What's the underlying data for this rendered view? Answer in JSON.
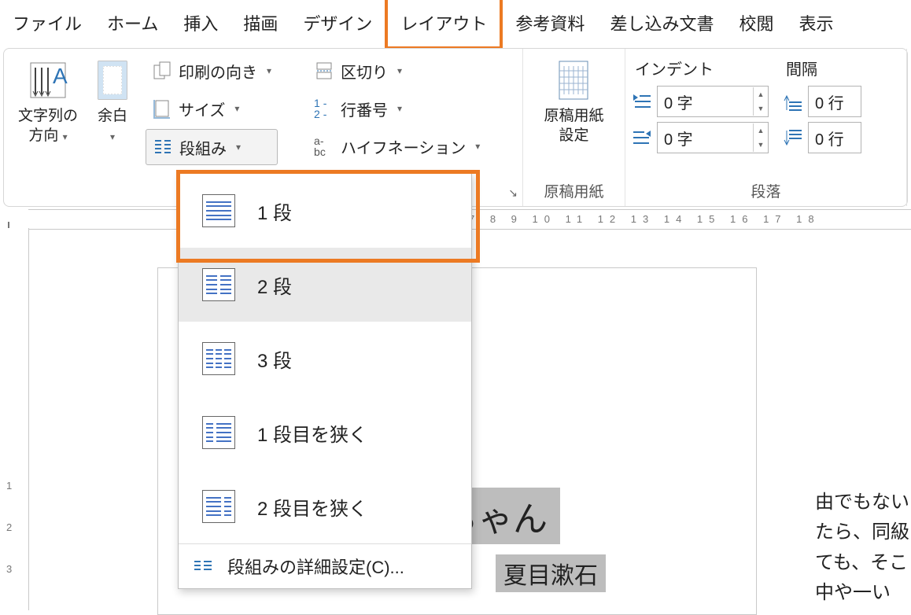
{
  "tabs": {
    "file": "ファイル",
    "home": "ホーム",
    "insert": "挿入",
    "draw": "描画",
    "design": "デザイン",
    "layout": "レイアウト",
    "references": "参考資料",
    "mailings": "差し込み文書",
    "review": "校閲",
    "view": "表示"
  },
  "ribbon": {
    "text_direction": "文字列の\n方向",
    "margins": "余白",
    "orientation": "印刷の向き",
    "size": "サイズ",
    "columns": "段組み",
    "breaks": "区切り",
    "line_numbers": "行番号",
    "hyphenation": "ハイフネーション",
    "manuscript": "原稿用紙\n設定",
    "manuscript_group": "原稿用紙",
    "indent_label": "インデント",
    "spacing_label": "間隔",
    "indent_left": "0 字",
    "indent_right": "0 字",
    "space_before": "0 行",
    "space_after": "0 行",
    "paragraph_group": "段落"
  },
  "columns_menu": {
    "one": "1 段",
    "two": "2 段",
    "three": "3 段",
    "left": "1 段目を狭く",
    "right": "2 段目を狭く",
    "more": "段組みの詳細設定(C)..."
  },
  "ruler_h": "7  8  9  10 11 12 13 14 15 16 17 18",
  "ruler_v": [
    "1",
    "2",
    "3"
  ],
  "document": {
    "title": "坊っちゃん",
    "author": "夏目漱石",
    "side1": "由でもない",
    "side2": "たら、同級",
    "side3": "ても、そこ",
    "side4": "中や一い"
  }
}
